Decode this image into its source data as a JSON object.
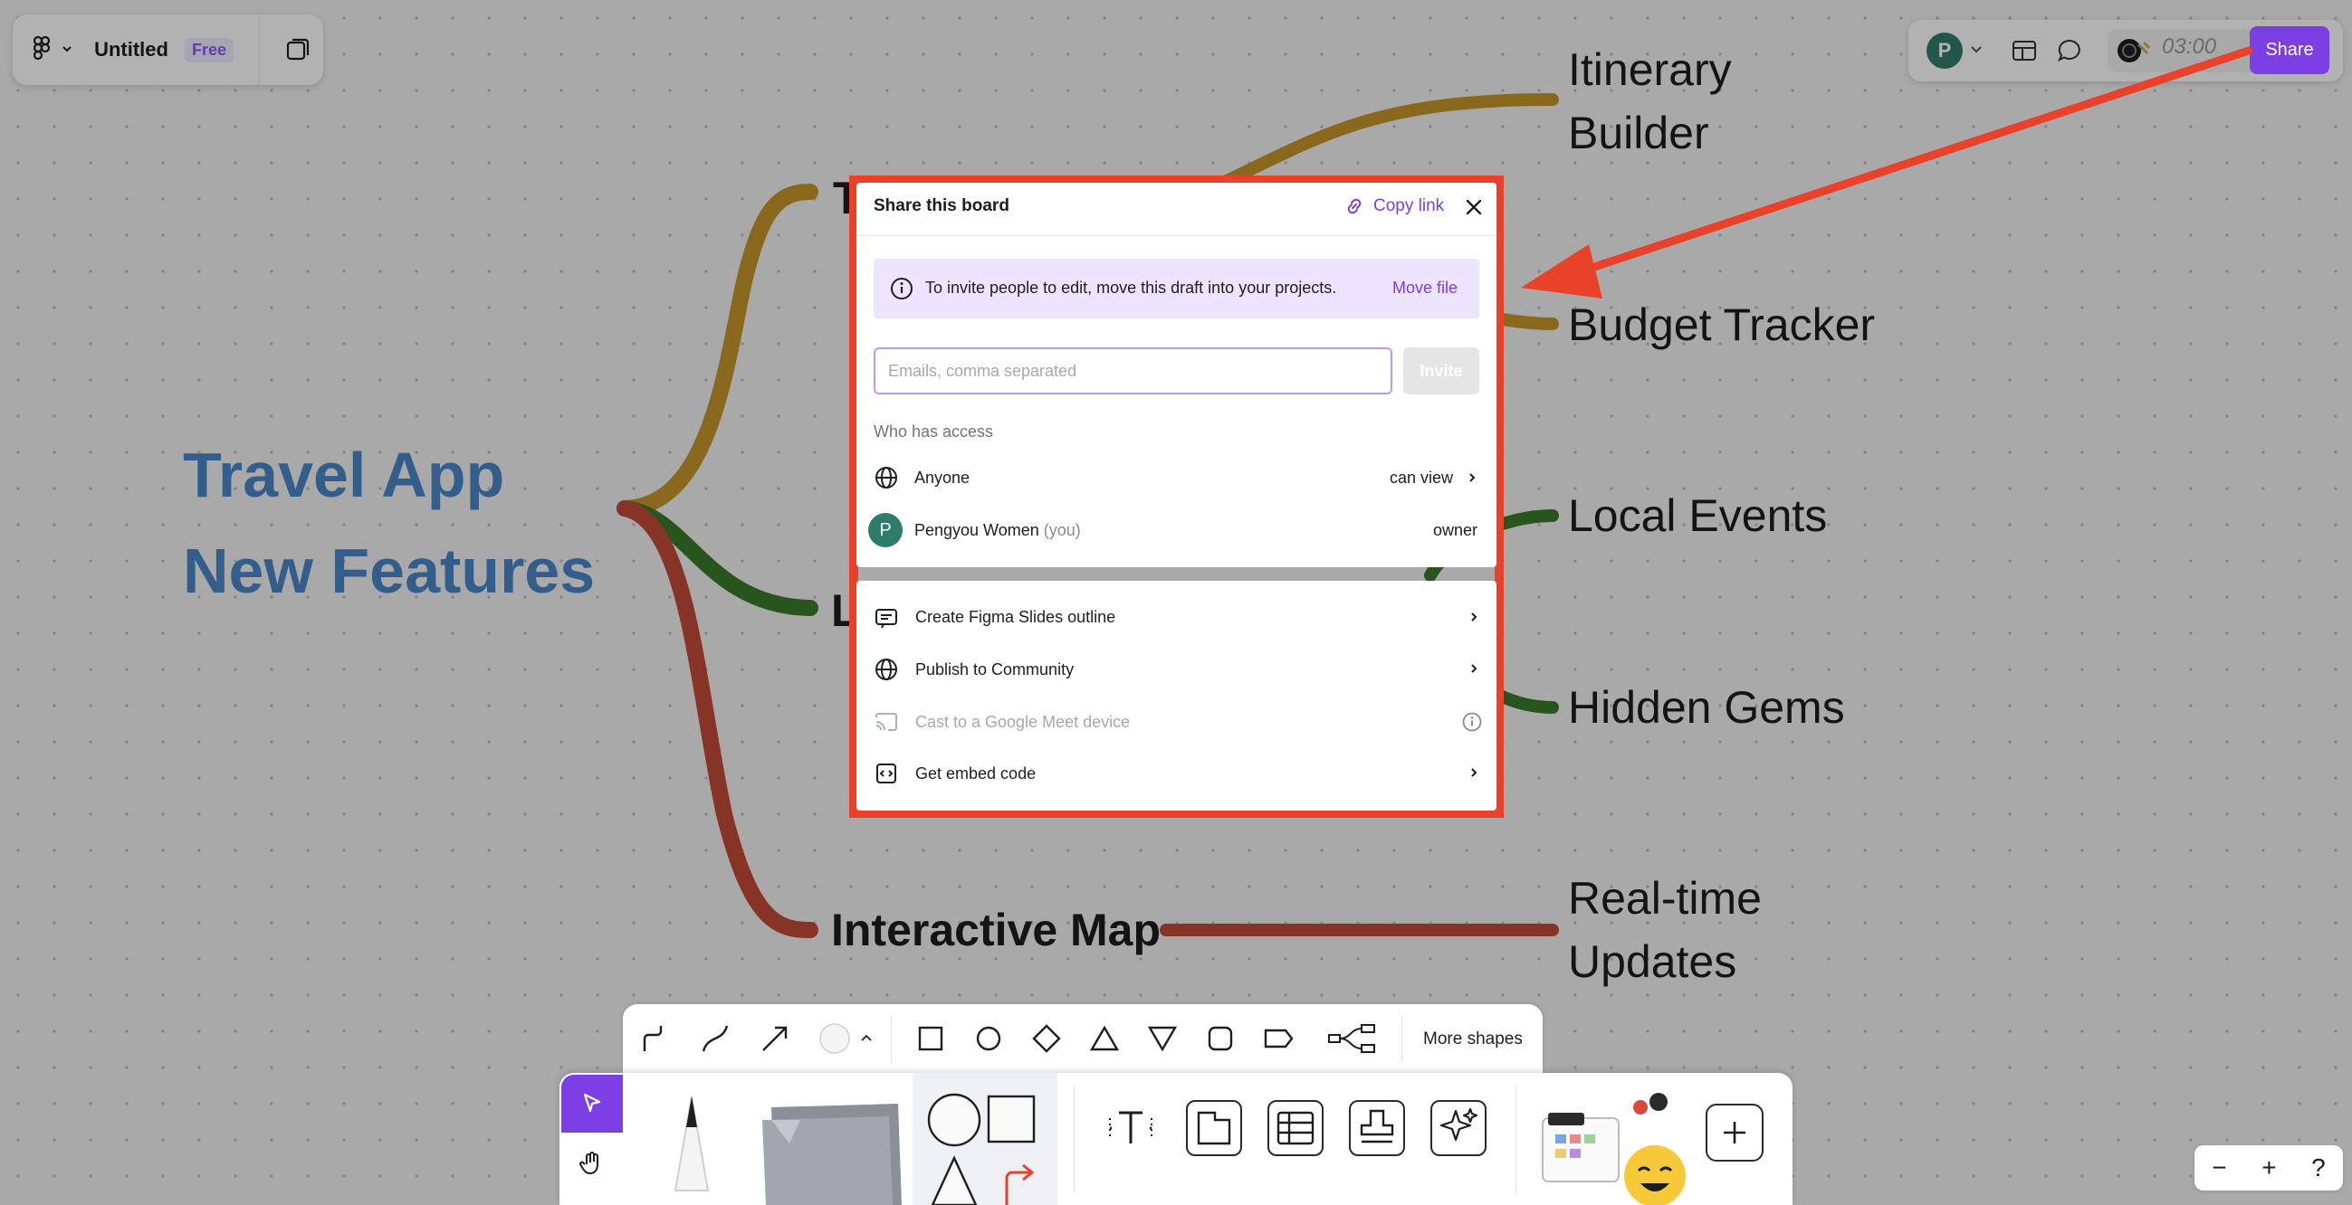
{
  "canvas": {
    "root": {
      "line1": "Travel App",
      "line2": "New Features"
    },
    "nodes": {
      "t_node": "T",
      "l_node": "L",
      "interactive_map": "Interactive Map",
      "itinerary_line1": "Itinerary",
      "itinerary_line2": "Builder",
      "budget_tracker": "Budget Tracker",
      "local_events": "Local Events",
      "hidden_gems": "Hidden Gems",
      "realtime_line1": "Real-time",
      "realtime_line2": "Updates"
    },
    "colors": {
      "root_text": "#4a86c8",
      "branch_gold": "#c5962b",
      "branch_green": "#3a7a2a",
      "branch_red": "#c24a36"
    }
  },
  "header": {
    "file_title": "Untitled",
    "plan_badge": "Free",
    "user_initial": "P",
    "timer": "03:00",
    "share_label": "Share"
  },
  "share_modal": {
    "title": "Share this board",
    "copy_link": "Copy link",
    "banner": {
      "text": "To invite people to edit, move this draft into your projects.",
      "action": "Move file"
    },
    "email_placeholder": "Emails, comma separated",
    "invite_label": "Invite",
    "access_label": "Who has access",
    "access_rows": [
      {
        "name": "Anyone",
        "suffix": "",
        "role": "can view"
      },
      {
        "name": "Pengyou Women",
        "suffix": "(you)",
        "role": "owner",
        "initial": "P"
      }
    ],
    "actions": [
      {
        "label": "Create Figma Slides outline"
      },
      {
        "label": "Publish to Community"
      },
      {
        "label": "Cast to a Google Meet device"
      },
      {
        "label": "Get embed code"
      }
    ],
    "accent": "#7b3fe4",
    "highlight_border": "#e8422b"
  },
  "bottom_toolbar": {
    "more_shapes": "More shapes"
  },
  "zoom": {
    "minus": "−",
    "plus": "+",
    "help": "?"
  }
}
